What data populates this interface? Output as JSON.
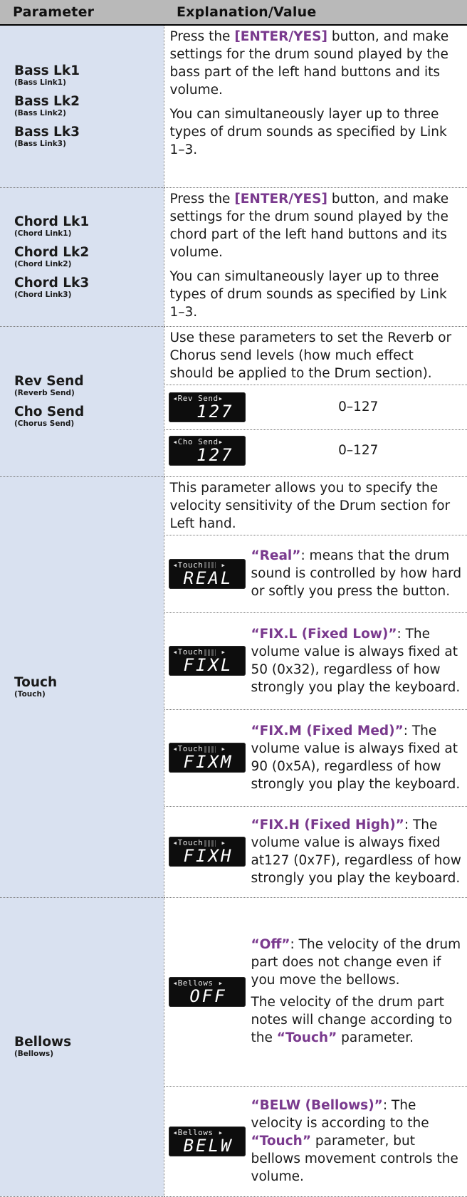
{
  "header": {
    "col1": "Parameter",
    "col2": "Explanation/Value"
  },
  "bass": {
    "params": [
      {
        "name": "Bass Lk1",
        "sub": "(Bass Link1)"
      },
      {
        "name": "Bass Lk2",
        "sub": "(Bass Link2)"
      },
      {
        "name": "Bass Lk3",
        "sub": "(Bass Link3)"
      }
    ],
    "p1_pre": "Press the ",
    "p1_btn": "[ENTER/YES]",
    "p1_post": " button, and make settings for the drum sound played by the bass part of the left hand buttons and its volume.",
    "p2": "You can simultaneously layer up to three types of drum sounds as specified by Link 1–3."
  },
  "chord": {
    "params": [
      {
        "name": "Chord Lk1",
        "sub": "(Chord Link1)"
      },
      {
        "name": "Chord Lk2",
        "sub": "(Chord Link2)"
      },
      {
        "name": "Chord Lk3",
        "sub": "(Chord Link3)"
      }
    ],
    "p1_pre": "Press the ",
    "p1_btn": "[ENTER/YES]",
    "p1_post": " button, and make settings for the drum sound played by the chord part of the left hand buttons and its volume.",
    "p2": "You can simultaneously layer up to three types of drum sounds as specified by Link 1–3."
  },
  "send": {
    "params": [
      {
        "name": "Rev Send",
        "sub": "(Reverb Send)"
      },
      {
        "name": "Cho Send",
        "sub": "(Chorus Send)"
      }
    ],
    "intro": "Use these parameters to set the Reverb or Chorus send levels (how much effect should be applied to the Drum section).",
    "rows": [
      {
        "lcd_top": "◂Rev Send▸",
        "lcd_big": "127",
        "value": "0–127"
      },
      {
        "lcd_top": "◂Cho Send▸",
        "lcd_big": "127",
        "value": "0–127"
      }
    ]
  },
  "touch": {
    "name": "Touch",
    "sub": "(Touch)",
    "intro": "This parameter allows you to specify the velocity sensitivity of the Drum section for Left hand.",
    "rows": [
      {
        "lcd_top": "◂Touch",
        "lcd_big": "REAL",
        "label": "“Real”",
        "text": ": means that the drum sound is controlled by how hard or softly you press the button."
      },
      {
        "lcd_top": "◂Touch",
        "lcd_big": "FIXL",
        "label": "“FIX.L (Fixed Low)”",
        "text": ": The volume value is always fixed at 50 (0x32), regardless of how strongly you play the keyboard."
      },
      {
        "lcd_top": "◂Touch",
        "lcd_big": "FIXM",
        "label": "“FIX.M (Fixed Med)”",
        "text": ": The volume value is always fixed at 90 (0x5A), regardless of how strongly you play the keyboard."
      },
      {
        "lcd_top": "◂Touch",
        "lcd_big": "FIXH",
        "label": "“FIX.H (Fixed High)”",
        "text": ": The volume value is always fixed at127 (0x7F), regardless of how strongly you play the keyboard."
      }
    ]
  },
  "bellows": {
    "name": "Bellows",
    "sub": "(Bellows)",
    "rows": [
      {
        "lcd_top": "◂Bellows ▸",
        "lcd_big": "OFF",
        "label": "“Off”",
        "text": ": The velocity of the drum part does not change even if you move the bellows.",
        "p2_pre": "The velocity of the drum part notes will change according to the ",
        "p2_hl": "“Touch”",
        "p2_post": " parameter."
      },
      {
        "lcd_top": "◂Bellows ▸",
        "lcd_big": "BELW",
        "label": "“BELW (Bellows)”",
        "text": ": The velocity is according to the ",
        "hl2": "“Touch”",
        "text2": " parameter, but bellows movement controls the volume."
      }
    ]
  },
  "colors": {
    "param_bg": "#d9e1f0",
    "header_bg": "#b9b9b9",
    "accent": "#7a3a8e",
    "lcd_bg": "#0d0d0d"
  }
}
